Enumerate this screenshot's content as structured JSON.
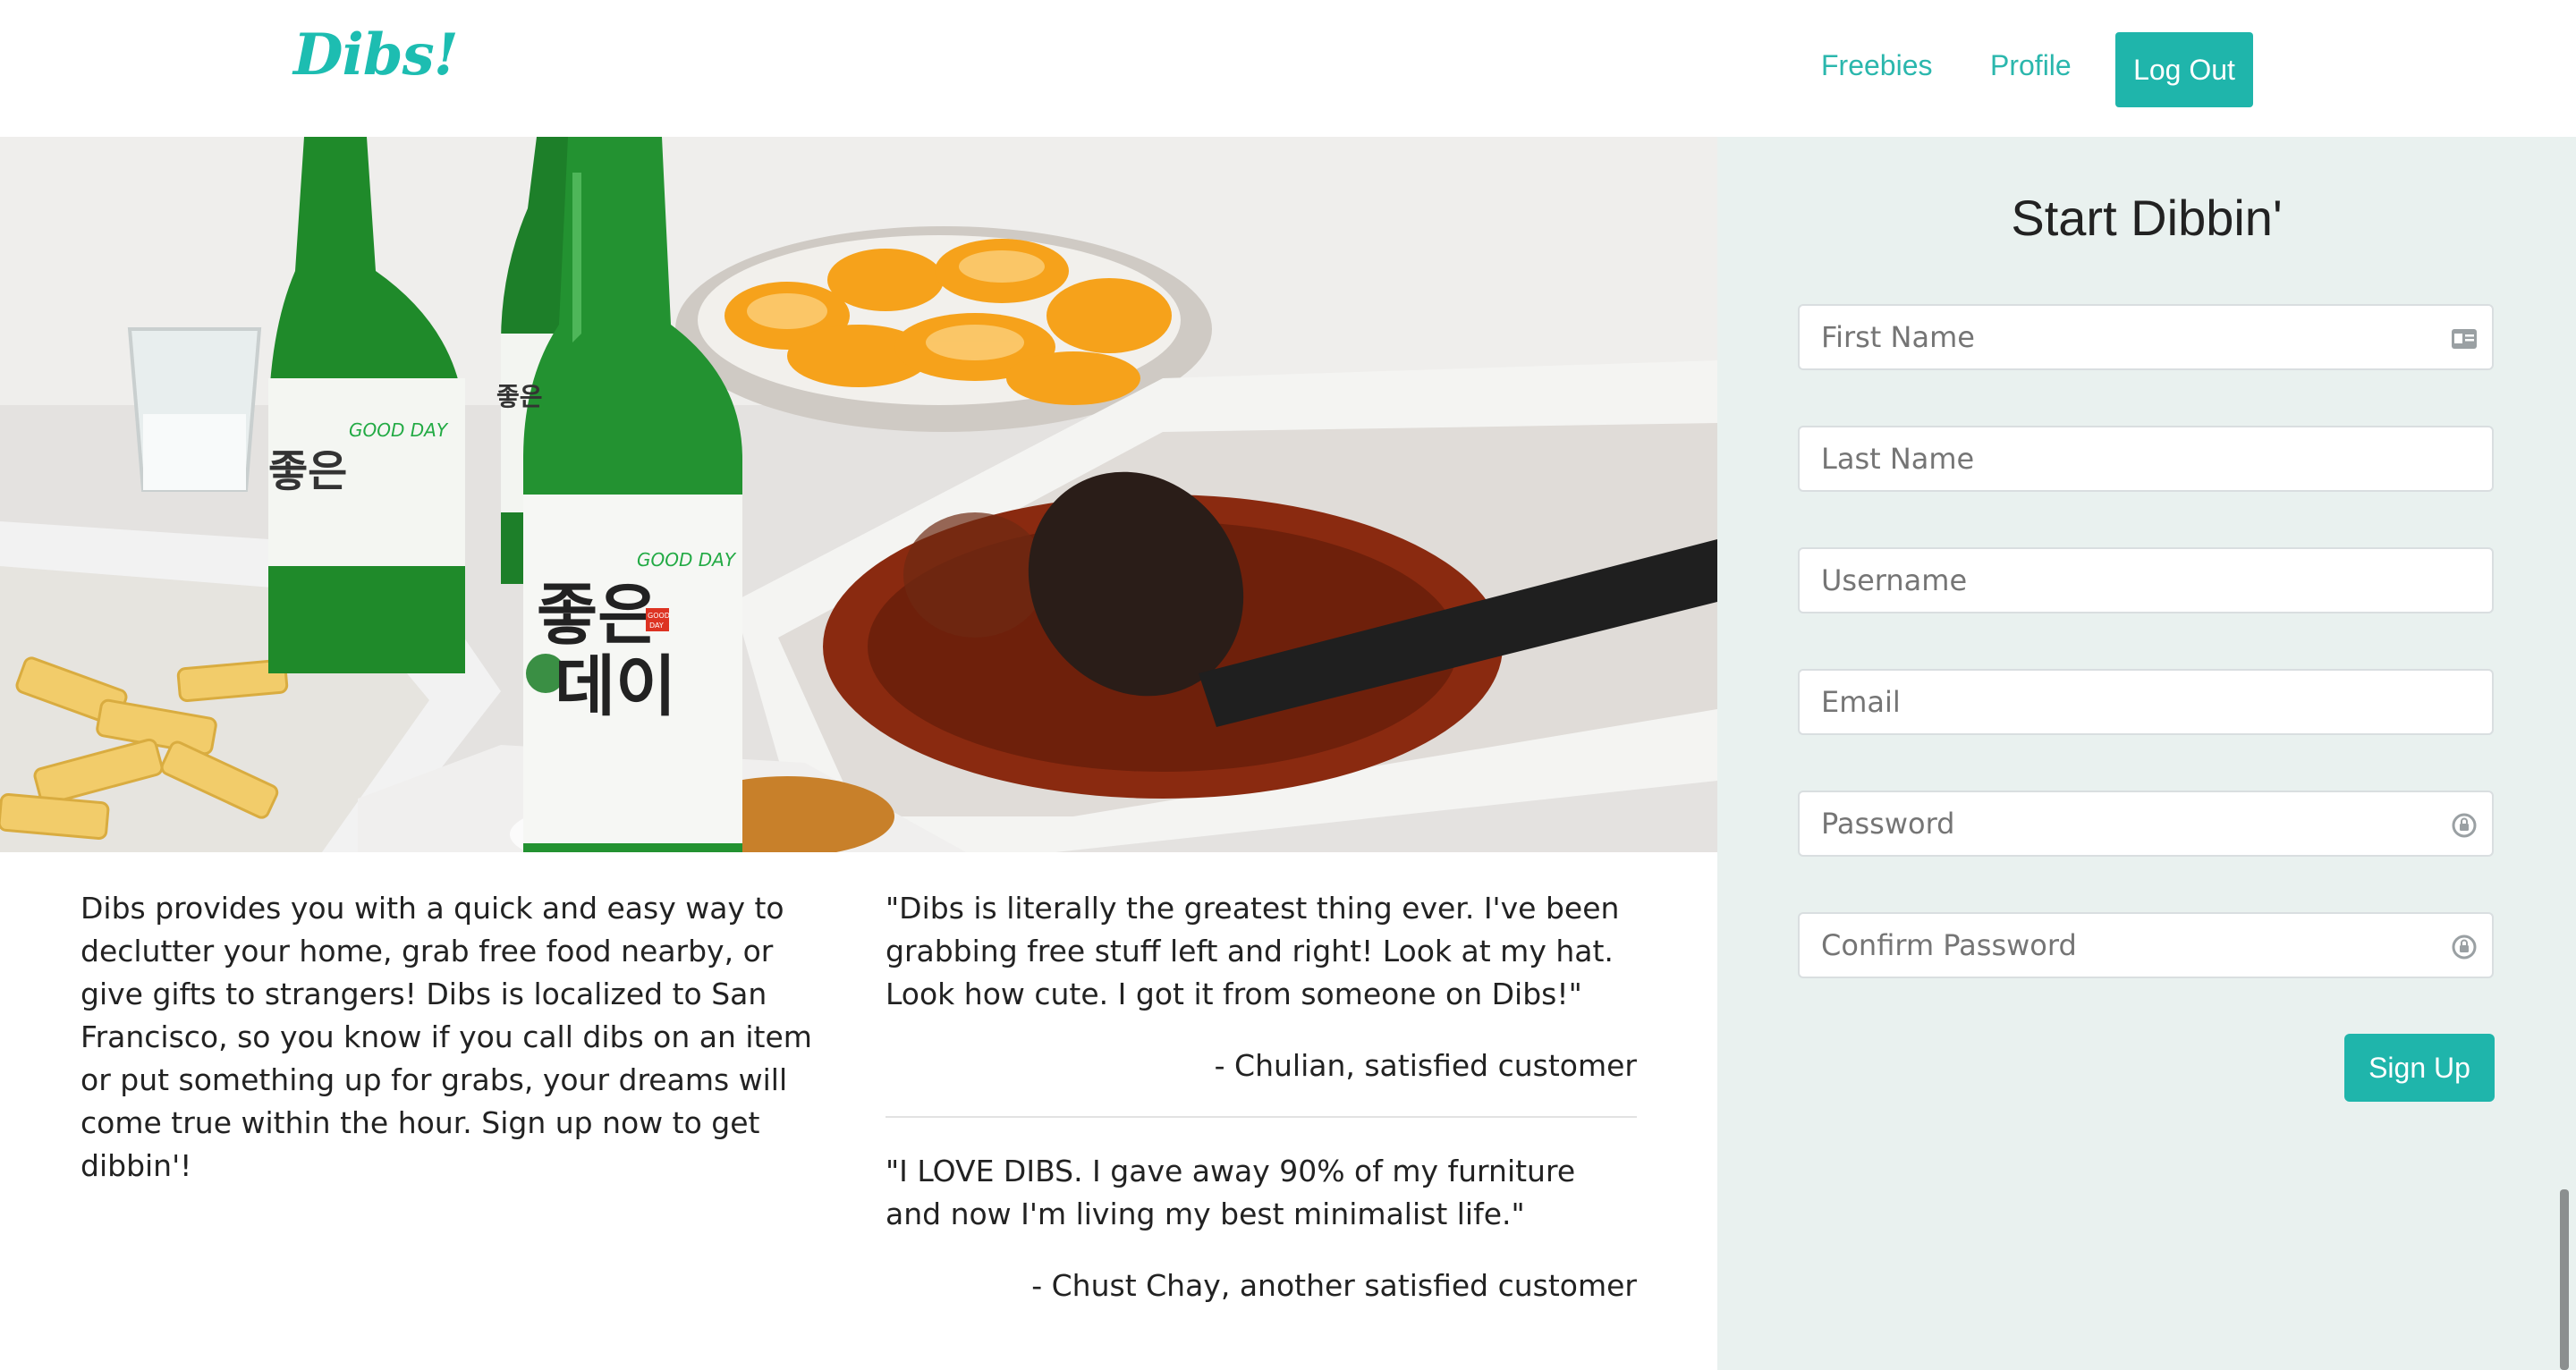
{
  "nav": {
    "brand": "Dibs!",
    "links": [
      {
        "label": "Freebies"
      },
      {
        "label": "Profile"
      }
    ],
    "logout_label": "Log Out"
  },
  "hero": {
    "image_label": "Korean food and soju bottles on a table",
    "bottle_text": [
      "좋은",
      "데이"
    ],
    "bottle_brand": "GOOD DAY",
    "badge_text": [
      "GOOD",
      "DAY"
    ]
  },
  "about": {
    "text": "Dibs provides you with a quick and easy way to declutter your home, grab free food nearby, or give gifts to strangers! Dibs is localized to San Francisco, so you know if you call dibs on an item or put something up for grabs, your dreams will come true within the hour. Sign up now to get dibbin'!"
  },
  "testimonials": [
    {
      "quote": "\"Dibs is literally the greatest thing ever. I've been grabbing free stuff left and right! Look at my hat. Look how cute. I got it from someone on Dibs!\"",
      "author": "- Chulian, satisfied customer"
    },
    {
      "quote": "\"I LOVE DIBS. I gave away 90% of my furniture and now I'm living my best minimalist life.\"",
      "author": "- Chust Chay, another satisfied customer"
    }
  ],
  "signup": {
    "title": "Start Dibbin'",
    "fields": {
      "first_name": {
        "placeholder": "First Name",
        "icon": "id-card-icon"
      },
      "last_name": {
        "placeholder": "Last Name"
      },
      "username": {
        "placeholder": "Username"
      },
      "email": {
        "placeholder": "Email"
      },
      "password": {
        "placeholder": "Password",
        "icon": "password-lock-icon"
      },
      "confirm_password": {
        "placeholder": "Confirm Password",
        "icon": "password-lock-icon"
      }
    },
    "submit_label": "Sign Up"
  },
  "colors": {
    "accent": "#1fb5ab",
    "panel_bg": "#e9f1ef"
  }
}
